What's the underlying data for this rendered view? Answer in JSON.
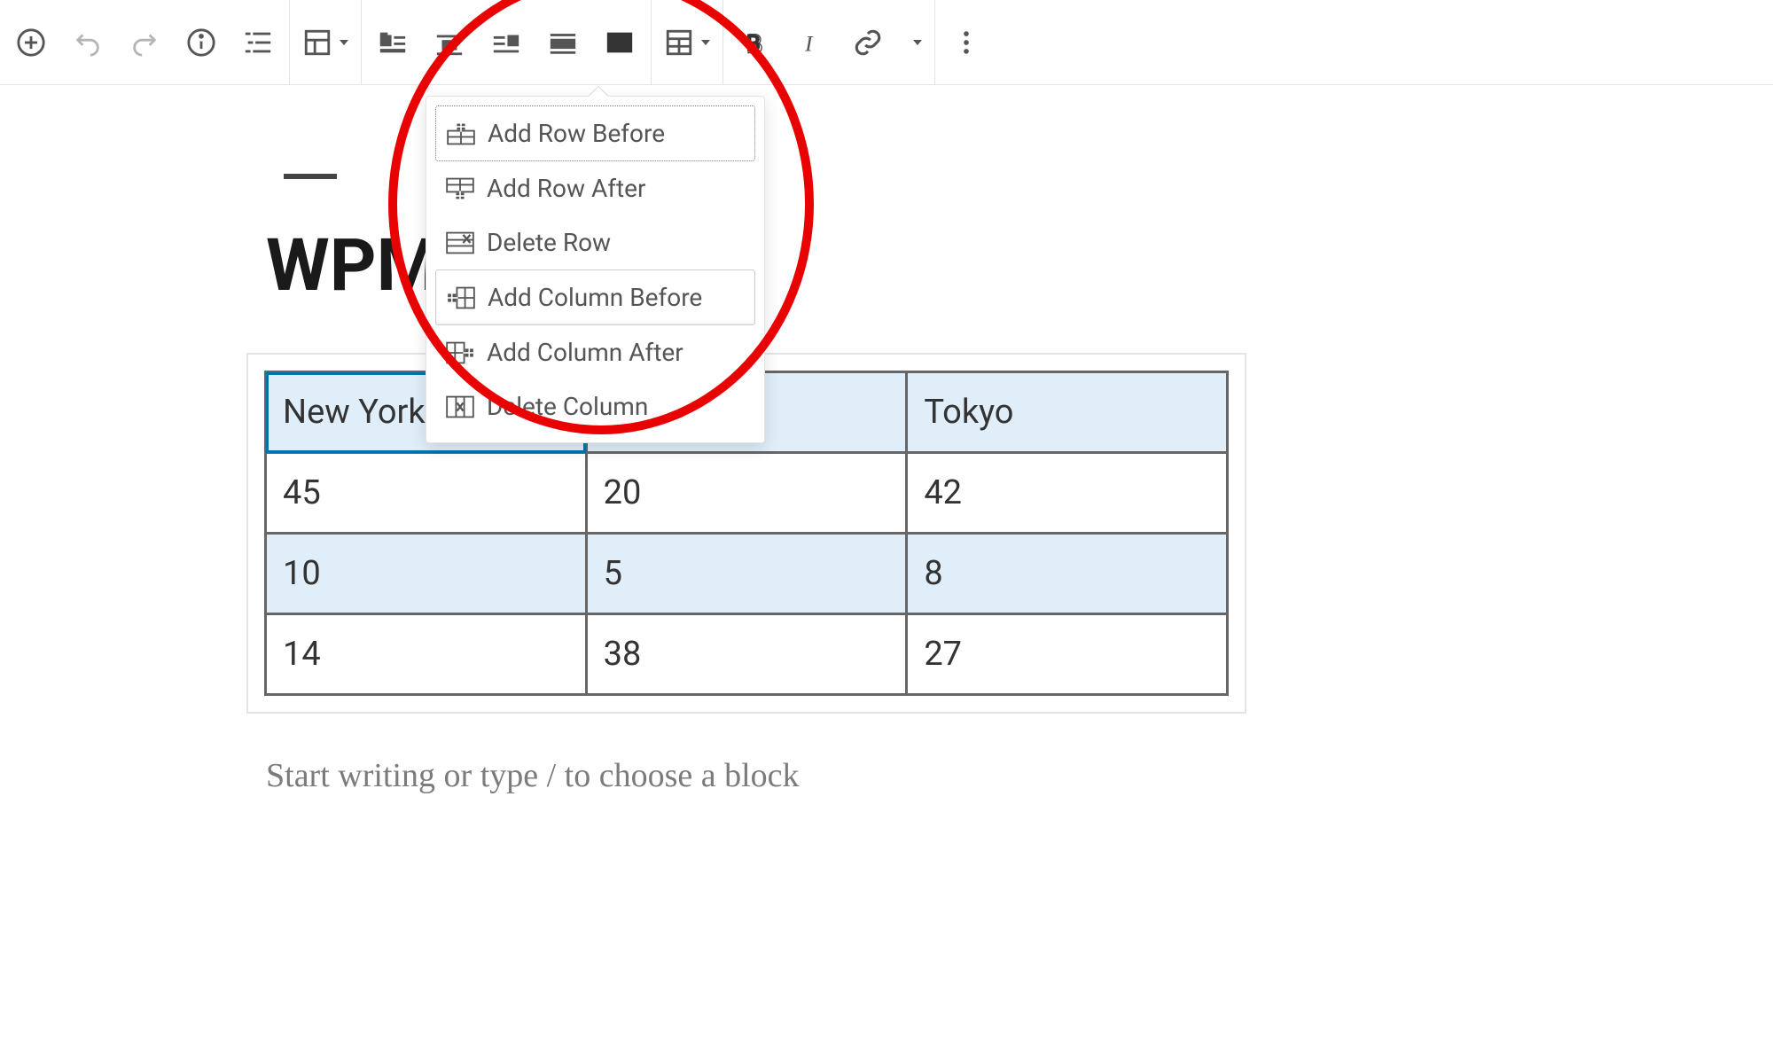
{
  "title": "WPMar",
  "placeholder": "Start writing or type / to choose a block",
  "table": {
    "header": [
      "New York",
      "",
      "Tokyo"
    ],
    "rows": [
      [
        "45",
        "20",
        "42"
      ],
      [
        "10",
        "5",
        "8"
      ],
      [
        "14",
        "38",
        "27"
      ]
    ]
  },
  "dropdown": {
    "items": [
      {
        "label": "Add Row Before"
      },
      {
        "label": "Add Row After"
      },
      {
        "label": "Delete Row"
      },
      {
        "label": "Add Column Before"
      },
      {
        "label": "Add Column After"
      },
      {
        "label": "Delete Column"
      }
    ],
    "focused_index": 0,
    "hovered_index": 3
  }
}
